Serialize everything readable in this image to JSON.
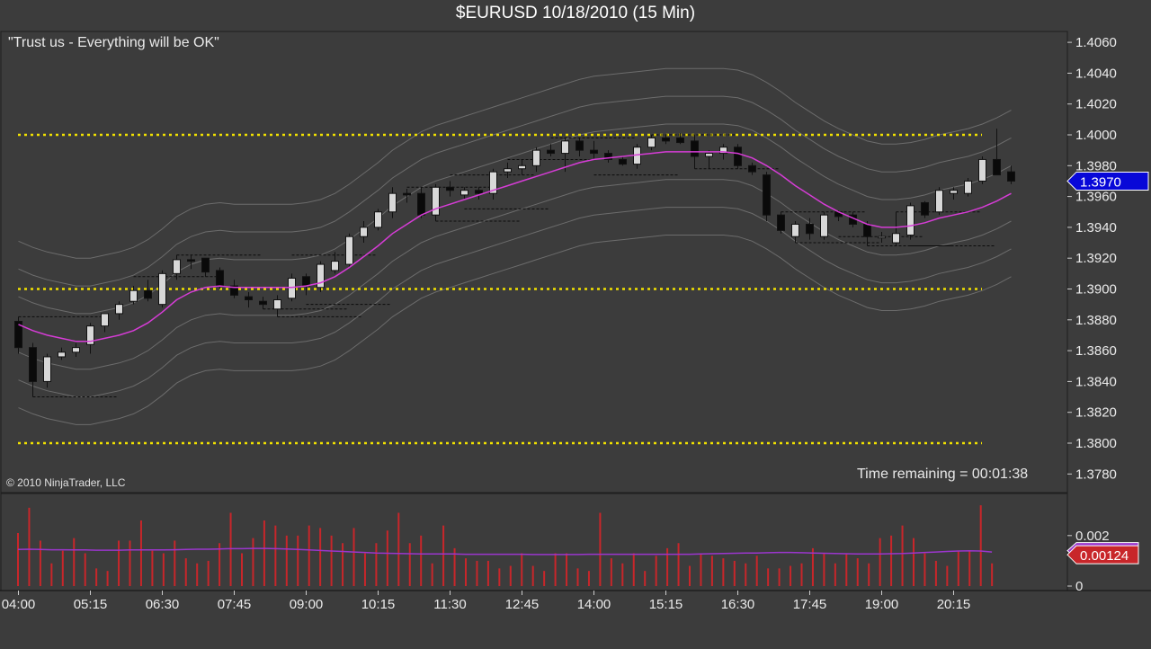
{
  "title": "$EURUSD  10/18/2010 (15 Min)",
  "subtitle": "\"Trust us - Everything will be OK\"",
  "copyright": "© 2010 NinjaTrader, LLC",
  "time_remaining": "Time remaining = 00:01:38",
  "colors": {
    "background": "#3c3c3c",
    "up_candle": "#d8d8d8",
    "down_candle": "#0a0a0a",
    "sma": "#d63cd6",
    "bands": "#6c6c6c",
    "levels": "#f2e200",
    "volume": "#c8262a",
    "volume_avg": "#9a36cc",
    "price_marker": "#0808d8",
    "volume_marker": "#c8262a"
  },
  "chart_data": [
    {
      "type": "candlestick",
      "title": "$EURUSD  10/18/2010 (15 Min)",
      "interval_minutes": 15,
      "x_ticks": [
        "04:00",
        "05:15",
        "06:30",
        "07:45",
        "09:00",
        "10:15",
        "11:30",
        "12:45",
        "14:00",
        "15:15",
        "16:30",
        "17:45",
        "19:00",
        "20:15"
      ],
      "y_ticks": [
        "1.4060",
        "1.4040",
        "1.4020",
        "1.4000",
        "1.3980",
        "1.3960",
        "1.3940",
        "1.3920",
        "1.3900",
        "1.3880",
        "1.3860",
        "1.3840",
        "1.3820",
        "1.3800",
        "1.3780"
      ],
      "ylim": [
        1.3761,
        1.4067
      ],
      "last_price": "1.3970",
      "horizontal_levels": [
        1.4,
        1.39,
        1.38
      ],
      "candles": [
        [
          1.3879,
          1.3882,
          1.3858,
          1.3862
        ],
        [
          1.3862,
          1.3865,
          1.383,
          1.384
        ],
        [
          1.384,
          1.3858,
          1.3836,
          1.3856
        ],
        [
          1.3856,
          1.3862,
          1.3854,
          1.3859
        ],
        [
          1.3859,
          1.3865,
          1.3856,
          1.3862
        ],
        [
          1.3864,
          1.3878,
          1.3858,
          1.3876
        ],
        [
          1.3876,
          1.3884,
          1.3872,
          1.3884
        ],
        [
          1.3884,
          1.3892,
          1.388,
          1.389
        ],
        [
          1.3892,
          1.3902,
          1.389,
          1.3899
        ],
        [
          1.3899,
          1.3906,
          1.3892,
          1.3894
        ],
        [
          1.389,
          1.3912,
          1.3888,
          1.391
        ],
        [
          1.391,
          1.3922,
          1.3906,
          1.3919
        ],
        [
          1.3919,
          1.3922,
          1.3913,
          1.3918
        ],
        [
          1.392,
          1.392,
          1.3908,
          1.3911
        ],
        [
          1.3912,
          1.3914,
          1.39,
          1.3902
        ],
        [
          1.3902,
          1.3906,
          1.3894,
          1.3896
        ],
        [
          1.3895,
          1.3898,
          1.3888,
          1.3893
        ],
        [
          1.3892,
          1.3895,
          1.3887,
          1.389
        ],
        [
          1.3887,
          1.3896,
          1.3882,
          1.3893
        ],
        [
          1.3894,
          1.391,
          1.3892,
          1.3907
        ],
        [
          1.3908,
          1.391,
          1.3896,
          1.3902
        ],
        [
          1.3901,
          1.3918,
          1.3898,
          1.3916
        ],
        [
          1.3912,
          1.3924,
          1.391,
          1.3918
        ],
        [
          1.3916,
          1.3936,
          1.3914,
          1.3934
        ],
        [
          1.3934,
          1.3944,
          1.393,
          1.394
        ],
        [
          1.394,
          1.3952,
          1.3938,
          1.395
        ],
        [
          1.395,
          1.3966,
          1.3946,
          1.3962
        ],
        [
          1.3962,
          1.3965,
          1.3956,
          1.3961
        ],
        [
          1.3962,
          1.3966,
          1.3946,
          1.3948
        ],
        [
          1.3948,
          1.3968,
          1.3944,
          1.3966
        ],
        [
          1.3966,
          1.397,
          1.396,
          1.3964
        ],
        [
          1.3961,
          1.3966,
          1.3958,
          1.3964
        ],
        [
          1.3964,
          1.3966,
          1.3958,
          1.3962
        ],
        [
          1.3962,
          1.3978,
          1.3958,
          1.3976
        ],
        [
          1.3976,
          1.3982,
          1.3972,
          1.3978
        ],
        [
          1.3978,
          1.3984,
          1.3974,
          1.398
        ],
        [
          1.398,
          1.3992,
          1.3976,
          1.399
        ],
        [
          1.399,
          1.3994,
          1.3986,
          1.3988
        ],
        [
          1.3988,
          1.3998,
          1.3976,
          1.3996
        ],
        [
          1.3996,
          1.3998,
          1.3986,
          1.399
        ],
        [
          1.399,
          1.3996,
          1.3984,
          1.3988
        ],
        [
          1.3988,
          1.399,
          1.3982,
          1.3984
        ],
        [
          1.3984,
          1.3986,
          1.398,
          1.3981
        ],
        [
          1.3981,
          1.3994,
          1.3978,
          1.3992
        ],
        [
          1.3992,
          1.4,
          1.399,
          1.3998
        ],
        [
          1.3998,
          1.4,
          1.3994,
          1.3996
        ],
        [
          1.3998,
          1.4001,
          1.3994,
          1.3995
        ],
        [
          1.3996,
          1.4,
          1.3978,
          1.3986
        ],
        [
          1.3986,
          1.399,
          1.3978,
          1.3988
        ],
        [
          1.3988,
          1.3994,
          1.3984,
          1.3992
        ],
        [
          1.3992,
          1.3994,
          1.3978,
          1.398
        ],
        [
          1.398,
          1.3982,
          1.3974,
          1.3976
        ],
        [
          1.3974,
          1.3976,
          1.3944,
          1.3948
        ],
        [
          1.3948,
          1.395,
          1.3936,
          1.3938
        ],
        [
          1.3934,
          1.3944,
          1.393,
          1.3942
        ],
        [
          1.3942,
          1.3946,
          1.3932,
          1.3936
        ],
        [
          1.3934,
          1.395,
          1.3932,
          1.3948
        ],
        [
          1.395,
          1.3951,
          1.3944,
          1.3947
        ],
        [
          1.3948,
          1.395,
          1.394,
          1.3942
        ],
        [
          1.3942,
          1.3944,
          1.3928,
          1.3934
        ],
        [
          1.3934,
          1.3937,
          1.393,
          1.3934
        ],
        [
          1.393,
          1.395,
          1.3928,
          1.3936
        ],
        [
          1.3935,
          1.3956,
          1.3932,
          1.3954
        ],
        [
          1.3956,
          1.3957,
          1.3946,
          1.3948
        ],
        [
          1.395,
          1.3966,
          1.3948,
          1.3964
        ],
        [
          1.3962,
          1.3966,
          1.3958,
          1.3964
        ],
        [
          1.3962,
          1.3972,
          1.396,
          1.397
        ],
        [
          1.397,
          1.3986,
          1.3968,
          1.3984
        ],
        [
          1.3984,
          1.4004,
          1.3976,
          1.3974
        ],
        [
          1.3976,
          1.398,
          1.3968,
          1.397
        ]
      ],
      "sma": [
        1.3877,
        1.3873,
        1.387,
        1.3868,
        1.3866,
        1.3866,
        1.3868,
        1.387,
        1.3873,
        1.3878,
        1.3885,
        1.3893,
        1.3898,
        1.3901,
        1.3902,
        1.3901,
        1.3901,
        1.3901,
        1.3901,
        1.3901,
        1.3902,
        1.3904,
        1.3908,
        1.3914,
        1.3921,
        1.3928,
        1.3936,
        1.3942,
        1.3948,
        1.3952,
        1.3955,
        1.3958,
        1.3961,
        1.3964,
        1.3967,
        1.397,
        1.3973,
        1.3976,
        1.3979,
        1.3982,
        1.3984,
        1.3985,
        1.3986,
        1.3987,
        1.3988,
        1.3989,
        1.3989,
        1.3989,
        1.3989,
        1.3989,
        1.3988,
        1.3985,
        1.398,
        1.3974,
        1.3967,
        1.3961,
        1.3955,
        1.395,
        1.3946,
        1.3942,
        1.394,
        1.394,
        1.3941,
        1.3943,
        1.3946,
        1.3948,
        1.395,
        1.3953,
        1.3957,
        1.3962
      ]
    },
    {
      "type": "bar",
      "y_ticks": [
        "0.002",
        "0"
      ],
      "ylim": [
        0,
        0.00356
      ],
      "last_value": "0.00124",
      "hidden_marker_value": "0.00140",
      "values": [
        0.0021,
        0.0031,
        0.0018,
        0.0009,
        0.0014,
        0.0019,
        0.0013,
        0.0007,
        0.0006,
        0.0018,
        0.0018,
        0.0026,
        0.0014,
        0.0013,
        0.0018,
        0.0011,
        0.0009,
        0.001,
        0.0017,
        0.0029,
        0.0013,
        0.0019,
        0.0026,
        0.0024,
        0.002,
        0.002,
        0.0024,
        0.0023,
        0.002,
        0.0017,
        0.0023,
        0.0013,
        0.0017,
        0.0022,
        0.0029,
        0.0017,
        0.002,
        0.0009,
        0.0024,
        0.0015,
        0.0011,
        0.001,
        0.001,
        0.0007,
        0.0008,
        0.0013,
        0.0008,
        0.0006,
        0.0013,
        0.0013,
        0.0007,
        0.0006,
        0.0029,
        0.0011,
        0.0009,
        0.0013,
        0.0006,
        0.0012,
        0.0015,
        0.0017,
        0.0008,
        0.0013,
        0.0012,
        0.0011,
        0.001,
        0.0009,
        0.0012,
        0.0007,
        0.0007,
        0.0008,
        0.0009,
        0.0015,
        0.0013,
        0.0009,
        0.0013,
        0.0011,
        0.0009,
        0.0019,
        0.002,
        0.0024,
        0.0019,
        0.0013,
        0.001,
        0.0008,
        0.0014,
        0.0014,
        0.0032,
        0.0009
      ],
      "avg": [
        0.00145,
        0.00146,
        0.00145,
        0.00144,
        0.00144,
        0.00143,
        0.00143,
        0.00142,
        0.00142,
        0.00142,
        0.00143,
        0.00143,
        0.00143,
        0.00143,
        0.00144,
        0.00145,
        0.00146,
        0.00146,
        0.00147,
        0.00148,
        0.00148,
        0.00149,
        0.00149,
        0.00148,
        0.00147,
        0.00145,
        0.00143,
        0.00141,
        0.00139,
        0.00137,
        0.00135,
        0.00133,
        0.00131,
        0.0013,
        0.00129,
        0.00128,
        0.00127,
        0.00127,
        0.00127,
        0.00127,
        0.00126,
        0.00126,
        0.00126,
        0.00126,
        0.00126,
        0.00126,
        0.00125,
        0.00125,
        0.00125,
        0.00125,
        0.00125,
        0.00126,
        0.00126,
        0.00126,
        0.00126,
        0.00126,
        0.00126,
        0.00126,
        0.00126,
        0.00126,
        0.00126,
        0.00127,
        0.00128,
        0.00129,
        0.0013,
        0.00131,
        0.00131,
        0.00132,
        0.00133,
        0.00133,
        0.00132,
        0.00131,
        0.0013,
        0.00129,
        0.00128,
        0.00127,
        0.00127,
        0.00127,
        0.00128,
        0.00129,
        0.00131,
        0.00133,
        0.00135,
        0.00137,
        0.00139,
        0.0014,
        0.00139,
        0.00135
      ]
    }
  ]
}
